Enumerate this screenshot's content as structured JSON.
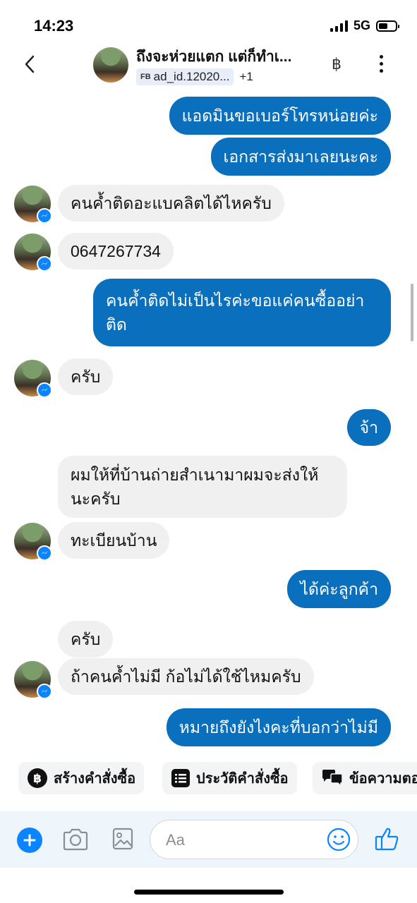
{
  "status": {
    "time": "14:23",
    "network": "5G"
  },
  "header": {
    "title": "ถึงจะห่วยแตก แต่ก็ทำเ...",
    "fb_tag": "FB",
    "ad_id": "ad_id.12020...",
    "extra_count": "+1",
    "currency_icon": "฿"
  },
  "messages": [
    {
      "dir": "out",
      "text": "แอดมินขอเบอร์โทรหน่อยค่ะ"
    },
    {
      "dir": "out",
      "text": "เอกสารส่งมาเลยนะคะ"
    },
    {
      "dir": "in",
      "text": "คนค้ำติดอะแบคลิตได้ไหครับ"
    },
    {
      "dir": "in",
      "text": "0647267734"
    },
    {
      "dir": "out",
      "lines": [
        "คนค้ำติดไม่เป็นไรค่ะขอแค่คนซื้ออย่า",
        "ติด"
      ]
    },
    {
      "dir": "in",
      "text": "ครับ"
    },
    {
      "dir": "out",
      "text": "จ้า"
    },
    {
      "dir": "in",
      "lines": [
        "ผมให้ที่บ้านถ่ายสำเนามาผมจะส่งให้",
        "นะครับ"
      ]
    },
    {
      "dir": "in",
      "text": "ทะเบียนบ้าน"
    },
    {
      "dir": "out",
      "text": "ได้ค่ะลูกค้า"
    },
    {
      "dir": "in",
      "text": "ครับ"
    },
    {
      "dir": "in",
      "text": "ถ้าคนค้ำไม่มี ก้อไม่ได้ใช้ไหมครับ"
    },
    {
      "dir": "out",
      "text": "หมายถึงยังไงคะที่บอกว่าไม่มี"
    }
  ],
  "quick_actions": [
    {
      "label": "สร้างคำสั่งซื้อ",
      "icon": "baht-circle-icon"
    },
    {
      "label": "ประวัติคำสั่งซื้อ",
      "icon": "list-icon"
    },
    {
      "label": "ข้อความตอ",
      "icon": "chat-bubbles-icon"
    }
  ],
  "composer": {
    "placeholder": "Aa"
  }
}
